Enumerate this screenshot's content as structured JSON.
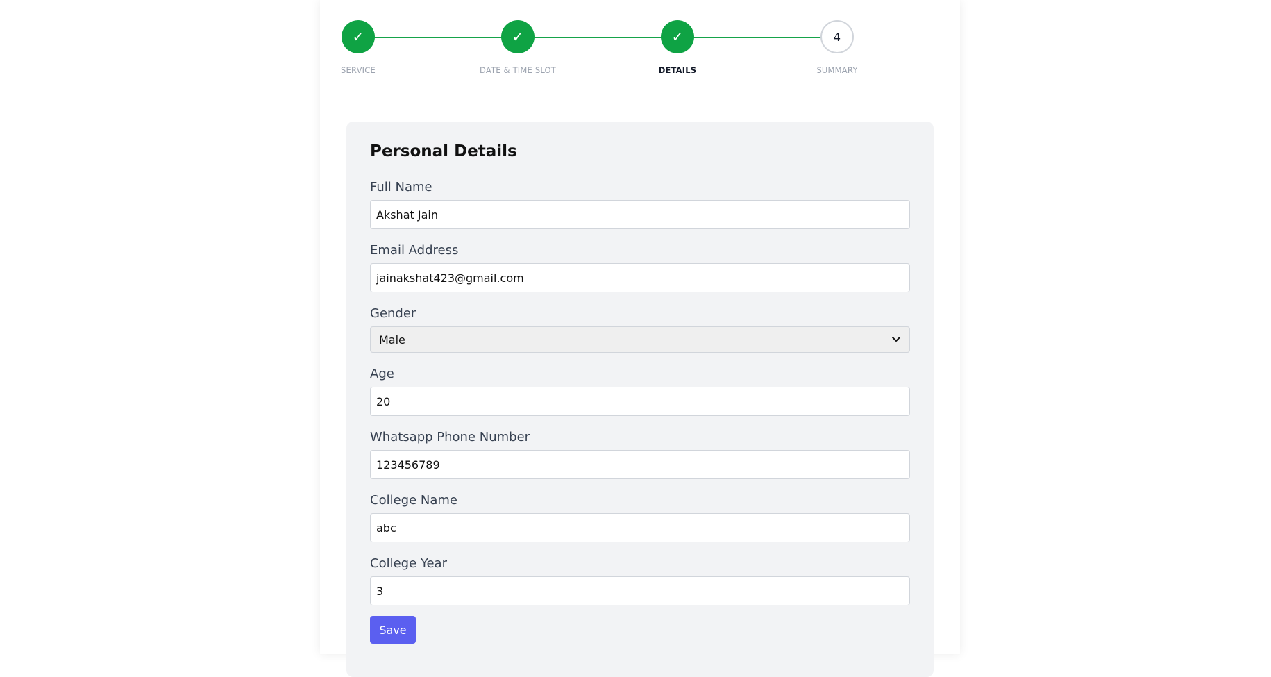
{
  "stepper": {
    "steps": [
      {
        "label": "SERVICE",
        "status": "complete",
        "glyph": "✓"
      },
      {
        "label": "DATE & TIME SLOT",
        "status": "complete",
        "glyph": "✓"
      },
      {
        "label": "DETAILS",
        "status": "active",
        "glyph": "✓"
      },
      {
        "label": "SUMMARY",
        "status": "pending",
        "glyph": "4"
      }
    ],
    "colors": {
      "complete": "#0fa344",
      "connector": "#16a34a",
      "pending_border": "#d1d5db"
    }
  },
  "form": {
    "title": "Personal Details",
    "fields": {
      "full_name": {
        "label": "Full Name",
        "value": "Akshat Jain"
      },
      "email": {
        "label": "Email Address",
        "value": "jainakshat423@gmail.com"
      },
      "gender": {
        "label": "Gender",
        "value": "Male"
      },
      "age": {
        "label": "Age",
        "value": "20"
      },
      "phone": {
        "label": "Whatsapp Phone Number",
        "value": "123456789"
      },
      "college_name": {
        "label": "College Name",
        "value": "abc"
      },
      "college_year": {
        "label": "College Year",
        "value": "3"
      }
    },
    "save_label": "Save",
    "save_color": "#5b5ff0",
    "card_background": "#f2f3f5"
  },
  "icons": {
    "check": "check-icon",
    "select_arrow": "chevron-down-icon"
  }
}
